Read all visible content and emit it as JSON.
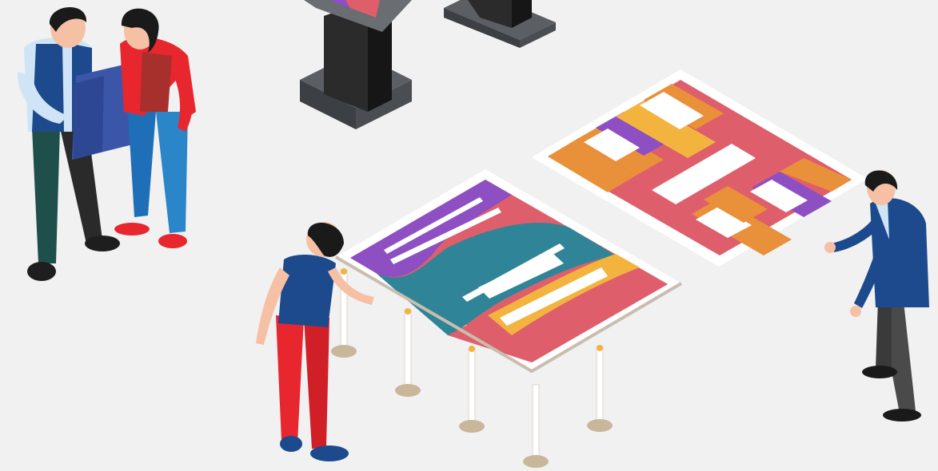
{
  "scene": {
    "description_hidden": "",
    "colors": {
      "background": "#f1f1f1",
      "purple": "#8e4fc3",
      "pink": "#de5f6b",
      "teal": "#2f8597",
      "yellow": "#f3b43f",
      "orange": "#e8903a",
      "navy": "#1c4a8c",
      "red": "#e8262e",
      "dark": "#2a2a2a",
      "skin": "#f6c0a4"
    },
    "icons": [
      "person-with-map-icon",
      "woman-in-red-icon",
      "kiosk-stand-icon",
      "exhibit-table-icon",
      "floor-mat-icon",
      "woman-leaning-icon",
      "man-in-suit-icon"
    ]
  }
}
